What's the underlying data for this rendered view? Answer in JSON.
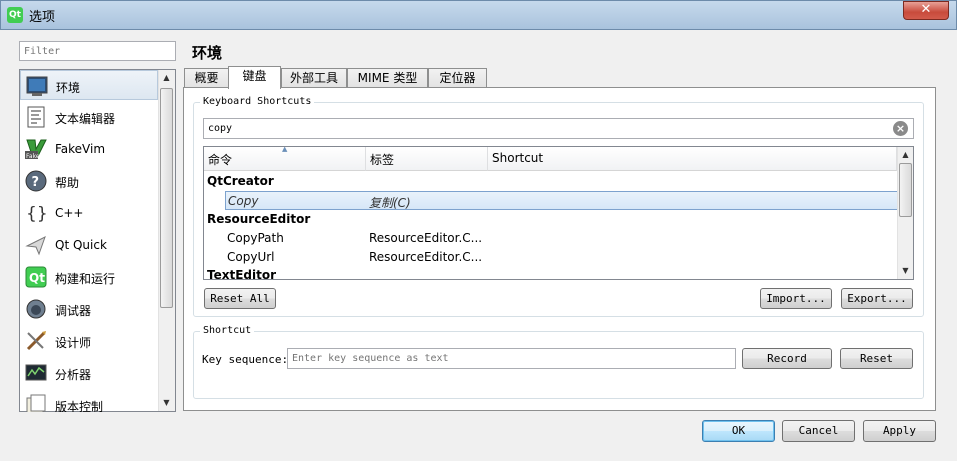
{
  "window": {
    "title": "选项",
    "app_icon": "Qt"
  },
  "filter": {
    "placeholder": "Filter"
  },
  "nav": {
    "items": [
      {
        "label": "环境",
        "icon": "monitor-icon",
        "selected": true
      },
      {
        "label": "文本编辑器",
        "icon": "text-editor-icon"
      },
      {
        "label": "FakeVim",
        "icon": "fakevim-icon"
      },
      {
        "label": "帮助",
        "icon": "help-icon"
      },
      {
        "label": "C++",
        "icon": "braces-icon"
      },
      {
        "label": "Qt Quick",
        "icon": "qtquick-icon"
      },
      {
        "label": "构建和运行",
        "icon": "build-run-icon"
      },
      {
        "label": "调试器",
        "icon": "debugger-icon"
      },
      {
        "label": "设计师",
        "icon": "designer-icon"
      },
      {
        "label": "分析器",
        "icon": "analyzer-icon"
      },
      {
        "label": "版本控制",
        "icon": "version-control-icon"
      }
    ]
  },
  "page": {
    "heading": "环境"
  },
  "tabs": [
    {
      "label": "概要"
    },
    {
      "label": "键盘",
      "active": true
    },
    {
      "label": "外部工具"
    },
    {
      "label": "MIME 类型"
    },
    {
      "label": "定位器"
    }
  ],
  "shortcuts_group": {
    "title": "Keyboard Shortcuts",
    "search_value": "copy",
    "columns": [
      "命令",
      "标签",
      "Shortcut"
    ],
    "rows": [
      {
        "type": "category",
        "command": "QtCreator"
      },
      {
        "type": "item",
        "command": "Copy",
        "label": "复制(C)",
        "shortcut": "",
        "selected": true
      },
      {
        "type": "category",
        "command": "ResourceEditor"
      },
      {
        "type": "item",
        "command": "CopyPath",
        "label": "ResourceEditor.C...",
        "shortcut": ""
      },
      {
        "type": "item",
        "command": "CopyUrl",
        "label": "ResourceEditor.C...",
        "shortcut": ""
      },
      {
        "type": "category",
        "command": "TextEditor"
      }
    ],
    "reset_all_label": "Reset All",
    "import_label": "Import...",
    "export_label": "Export..."
  },
  "shortcut_group": {
    "title": "Shortcut",
    "key_sequence_label": "Key sequence:",
    "key_sequence_placeholder": "Enter key sequence as text",
    "record_label": "Record",
    "reset_label": "Reset"
  },
  "dialog_buttons": {
    "ok": "OK",
    "cancel": "Cancel",
    "apply": "Apply"
  },
  "colors": {
    "selection_border": "#7da2ce",
    "default_button": "#3c7fb1",
    "close_button": "#c84b3c"
  }
}
